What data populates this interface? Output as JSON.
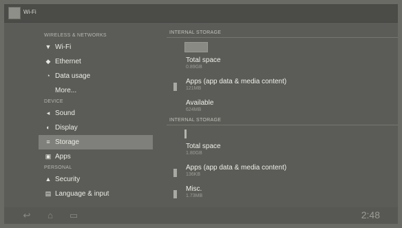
{
  "app": {
    "title": "Wi-Fi"
  },
  "sidebar": {
    "wireless_header": "WIRELESS & NETWORKS",
    "device_header": "DEVICE",
    "personal_header": "PERSONAL",
    "wifi": "Wi-Fi",
    "ethernet": "Ethernet",
    "data_usage": "Data usage",
    "more": "More...",
    "sound": "Sound",
    "display": "Display",
    "storage": "Storage",
    "apps": "Apps",
    "security": "Security",
    "language": "Language & input"
  },
  "internal": {
    "header": "INTERNAL STORAGE",
    "total_label": "Total space",
    "total_value": "0.89GB",
    "apps_label": "Apps (app data & media content)",
    "apps_value": "121MB",
    "available_label": "Available",
    "available_value": "624MB"
  },
  "second": {
    "header": "INTERNAL STORAGE",
    "total_label": "Total space",
    "total_value": "1.80GB",
    "apps_label": "Apps (app data & media content)",
    "apps_value": "136KB",
    "misc_label": "Misc.",
    "misc_value": "1.73MB"
  },
  "status": {
    "clock": "2:48"
  },
  "icons": {
    "wifi": "wifi-icon",
    "ethernet": "ethernet-icon",
    "data": "data-usage-icon",
    "sound": "sound-icon",
    "display": "display-icon",
    "storage": "storage-icon",
    "apps": "apps-icon",
    "security": "lock-icon",
    "language": "keyboard-icon"
  },
  "colors": {
    "selected": "#7f807b",
    "background": "#5b5c57"
  }
}
